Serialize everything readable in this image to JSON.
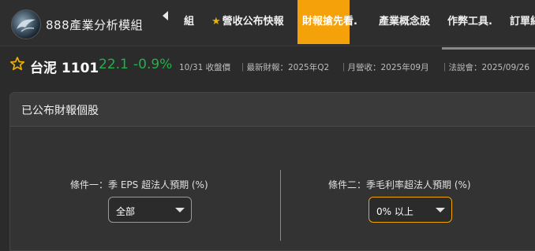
{
  "nav": {
    "brand": "888產業分析模組",
    "items": [
      {
        "label": "組",
        "active": false
      },
      {
        "label": "營收公布快報",
        "active": false,
        "icon": "star-icon"
      },
      {
        "label": "財報搶先看.",
        "active": true
      },
      {
        "label": "產業概念股",
        "active": false
      },
      {
        "label": "作弊工具.",
        "active": false
      },
      {
        "label": "訂單紀",
        "active": false
      }
    ],
    "active_color": "#f5a20a"
  },
  "stock": {
    "name": "台泥 1101",
    "price": "22.1",
    "change": "-0.9%",
    "close_note": "10/31 收盤價",
    "latest_report": "｜最新財報：2025年Q2",
    "monthly_revenue": "｜月營收：2025年09月",
    "investor_conf": "｜法說會：2025/09/26",
    "price_color": "#22b04b"
  },
  "card": {
    "title": "已公布財報個股",
    "condition1": {
      "label": "條件一：季 EPS 超法人預期 (%)",
      "selected": "全部"
    },
    "condition2": {
      "label": "條件二：季毛利率超法人預期 (%)",
      "selected": "0% 以上"
    }
  }
}
